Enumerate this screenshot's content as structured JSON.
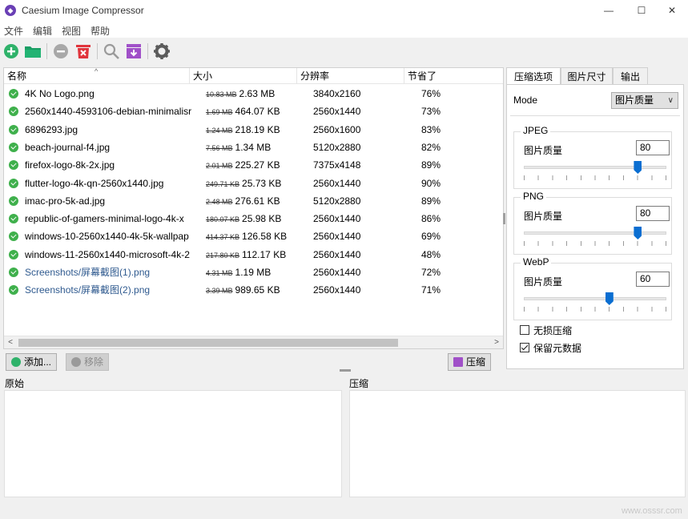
{
  "window": {
    "title": "Caesium Image Compressor",
    "app_icon": "caesium-logo-icon",
    "controls": [
      "—",
      "☐",
      "✕"
    ]
  },
  "menu": [
    "文件",
    "编辑",
    "视图",
    "帮助"
  ],
  "toolbar": {
    "icons": [
      "add-icon",
      "open-folder-icon",
      "remove-icon",
      "clear-list-icon",
      "preview-icon",
      "compress-icon",
      "settings-icon"
    ]
  },
  "file_list": {
    "columns": [
      "名称",
      "大小",
      "分辨率",
      "节省了"
    ],
    "rows": [
      {
        "name": "4K No Logo.png",
        "old_size": "10.83 MB",
        "new_size": "2.63 MB",
        "resolution": "3840x2160",
        "saved": "76%"
      },
      {
        "name": "2560x1440-4593106-debian-minimalisr",
        "old_size": "1.69 MB",
        "new_size": "464.07 KB",
        "resolution": "2560x1440",
        "saved": "73%"
      },
      {
        "name": "6896293.jpg",
        "old_size": "1.24 MB",
        "new_size": "218.19 KB",
        "resolution": "2560x1600",
        "saved": "83%"
      },
      {
        "name": "beach-journal-f4.jpg",
        "old_size": "7.56 MB",
        "new_size": "1.34 MB",
        "resolution": "5120x2880",
        "saved": "82%"
      },
      {
        "name": "firefox-logo-8k-2x.jpg",
        "old_size": "2.01 MB",
        "new_size": "225.27 KB",
        "resolution": "7375x4148",
        "saved": "89%"
      },
      {
        "name": "flutter-logo-4k-qn-2560x1440.jpg",
        "old_size": "249.71 KB",
        "new_size": "25.73 KB",
        "resolution": "2560x1440",
        "saved": "90%"
      },
      {
        "name": "imac-pro-5k-ad.jpg",
        "old_size": "2.48 MB",
        "new_size": "276.61 KB",
        "resolution": "5120x2880",
        "saved": "89%"
      },
      {
        "name": "republic-of-gamers-minimal-logo-4k-x",
        "old_size": "180.07 KB",
        "new_size": "25.98 KB",
        "resolution": "2560x1440",
        "saved": "86%"
      },
      {
        "name": "windows-10-2560x1440-4k-5k-wallpap",
        "old_size": "414.37 KB",
        "new_size": "126.58 KB",
        "resolution": "2560x1440",
        "saved": "69%"
      },
      {
        "name": "windows-11-2560x1440-microsoft-4k-2",
        "old_size": "217.80 KB",
        "new_size": "112.17 KB",
        "resolution": "2560x1440",
        "saved": "48%"
      },
      {
        "name": "Screenshots/屏幕截图(1).png",
        "old_size": "4.31 MB",
        "new_size": "1.19 MB",
        "resolution": "2560x1440",
        "saved": "72%"
      },
      {
        "name": "Screenshots/屏幕截图(2).png",
        "old_size": "3.39 MB",
        "new_size": "989.65 KB",
        "resolution": "2560x1440",
        "saved": "71%"
      }
    ]
  },
  "buttons": {
    "add": "添加...",
    "remove": "移除",
    "compress": "压缩"
  },
  "tabs": [
    "压缩选项",
    "图片尺寸",
    "输出"
  ],
  "options": {
    "mode_label": "Mode",
    "mode_value": "图片质量",
    "groups": [
      {
        "title": "JPEG",
        "label": "图片质量",
        "value": "80",
        "level": 0.8
      },
      {
        "title": "PNG",
        "label": "图片质量",
        "value": "80",
        "level": 0.8
      },
      {
        "title": "WebP",
        "label": "图片质量",
        "value": "60",
        "level": 0.6
      }
    ],
    "lossless": {
      "label": "无损压缩",
      "checked": false
    },
    "keep_metadata": {
      "label": "保留元数据",
      "checked": true
    }
  },
  "preview": {
    "original_label": "原始",
    "compressed_label": "压缩"
  },
  "watermark": "www.osssr.com",
  "colors": {
    "accent": "#0a6ed1",
    "ok_green": "#3fb04c",
    "clear_red": "#e0343c",
    "compress_purple": "#a050c8",
    "add_green": "#2fb26a"
  }
}
